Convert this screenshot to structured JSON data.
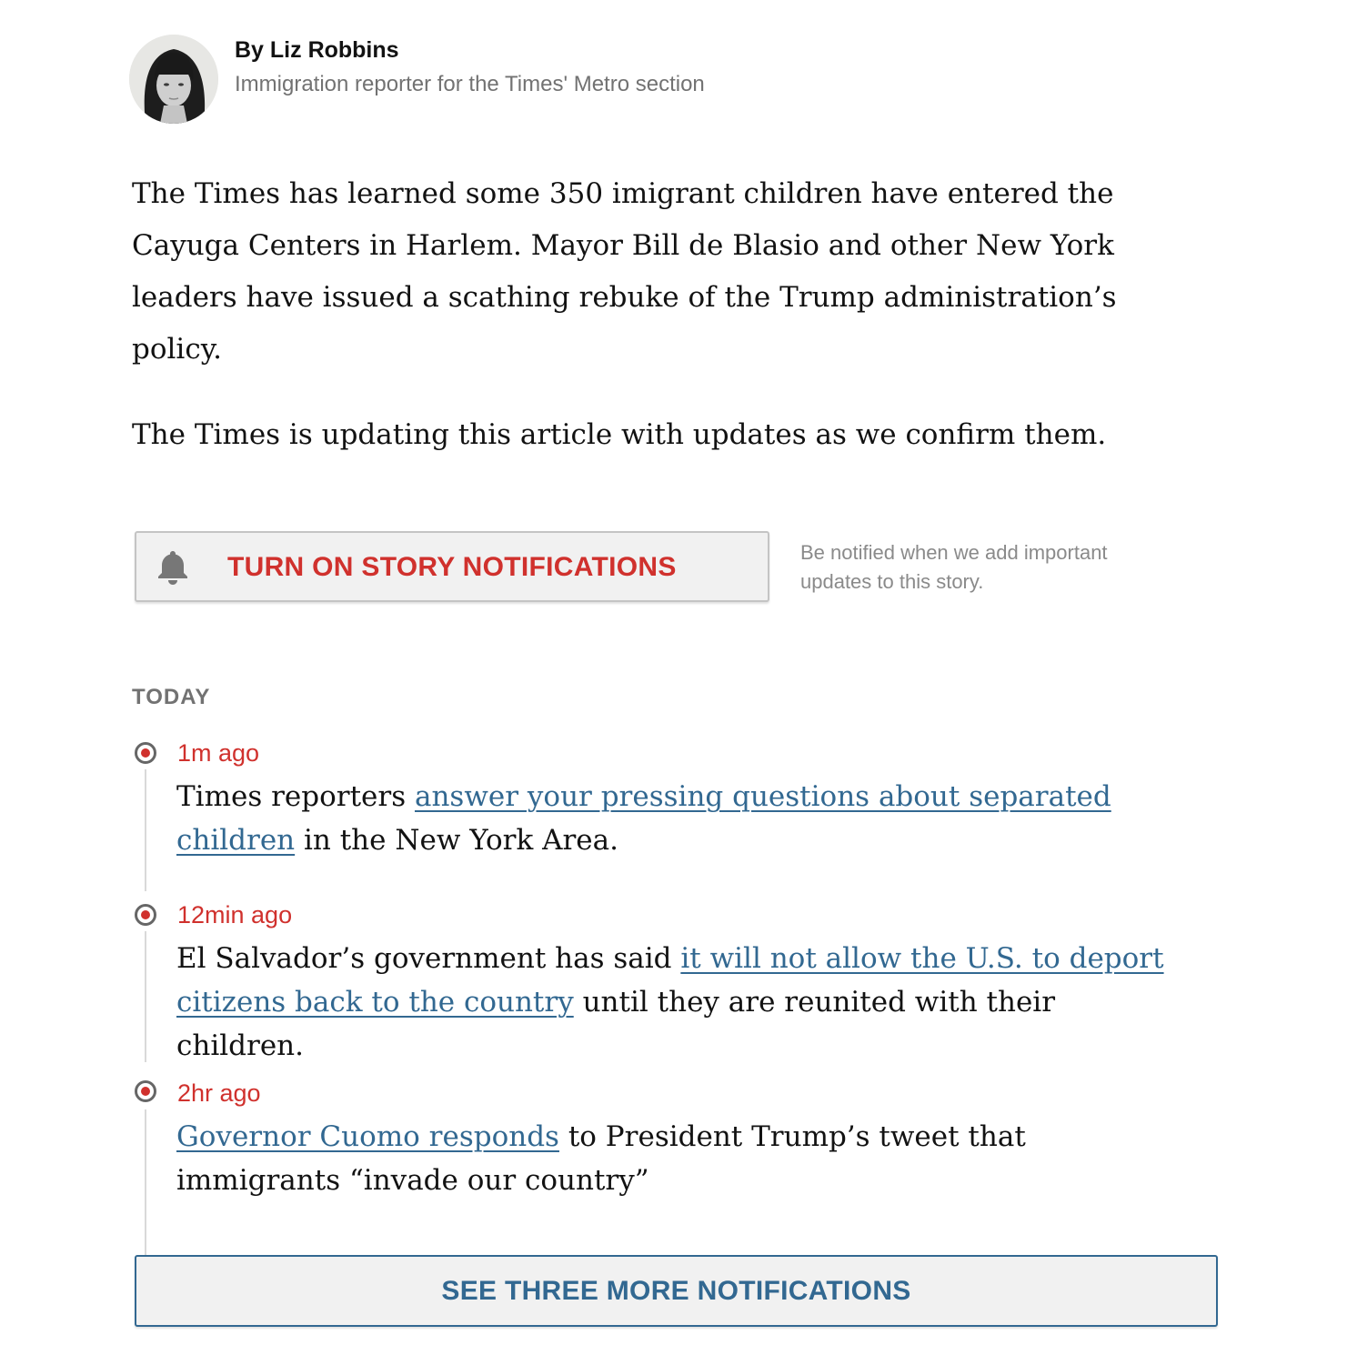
{
  "byline": {
    "name": "By Liz Robbins",
    "role": "Immigration reporter for the Times' Metro section"
  },
  "body": {
    "paragraph_1": "The Times has learned some 350 imigrant children have entered the Cayuga Centers in Harlem. Mayor Bill de Blasio and other New York leaders have issued a scathing rebuke of the Trump administration’s policy.",
    "paragraph_2": "The Times is updating this article with updates as we confirm them."
  },
  "notifications": {
    "button_label": "TURN ON STORY NOTIFICATIONS",
    "description": "Be notified when we add important updates to this story.",
    "bell_icon": "bell-icon"
  },
  "timeline": {
    "section_label": "TODAY",
    "entries": [
      {
        "time": "1m ago",
        "text_before": "Times reporters ",
        "link": "answer your pressing questions about separated children",
        "text_after": " in the New York Area."
      },
      {
        "time": "12min ago",
        "text_before": "El Salvador’s government has said ",
        "link": "it will not allow the U.S. to deport citizens back to the country",
        "text_after": " until they are reunited with their children."
      },
      {
        "time": "2hr ago",
        "text_before": "",
        "link": "Governor Cuomo responds",
        "text_after": " to President Trump’s tweet that immigrants “invade our country”"
      }
    ],
    "more_button_label": "SEE THREE MORE NOTIFICATIONS"
  },
  "colors": {
    "accent_red": "#d0312d",
    "link_blue": "#326891",
    "muted_gray": "#727272"
  }
}
